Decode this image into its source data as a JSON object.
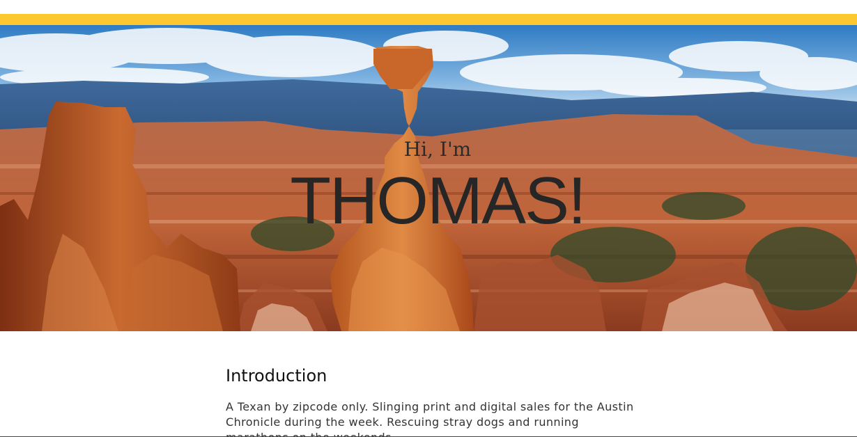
{
  "header": {
    "accent_color": "#fdc82f"
  },
  "hero": {
    "image_description": "canyon-hoodoo-landscape",
    "greeting": "Hi, I'm",
    "name": "THOMAS!"
  },
  "intro": {
    "heading": "Introduction",
    "body": "A Texan by zipcode only. Slinging print and digital sales for the Austin Chronicle during the week. Rescuing stray dogs and running marathons on the weekends."
  }
}
